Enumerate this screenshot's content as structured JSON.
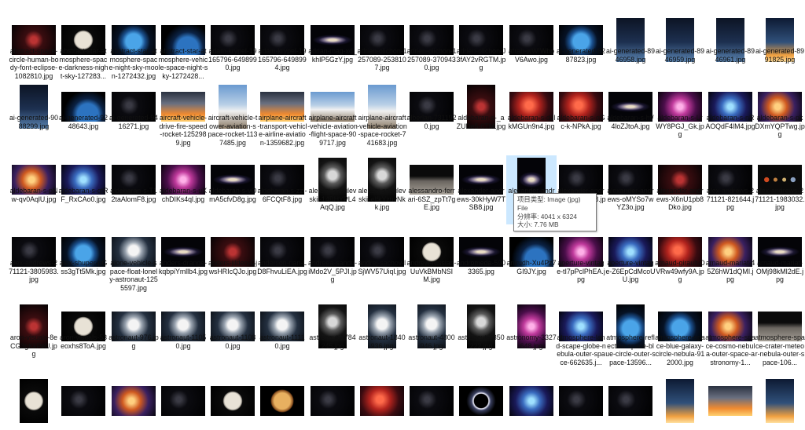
{
  "explorer": {
    "view": "large-icons",
    "tooltip": {
      "type_line": "项目类型: Image (jpg) File",
      "dims_line": "分辨率: 4041 x 6324",
      "size_line": "大小: 7.76 MB"
    },
    "rows": [
      [
        {
          "label": "abstract-space-circle-human-body-font-eclipse-1082810.jpg",
          "orient": "land",
          "style": "dark-red"
        },
        {
          "label": "abstract-star-atmosphere-space-darkness-night-sky-127283...",
          "orient": "land",
          "style": "moon"
        },
        {
          "label": "abstract-star-atmosphere-space-night-sky-moon-1272432.jpg",
          "orient": "land",
          "style": "earth"
        },
        {
          "label": "abstract-star-atmosphere-vehicle-space-night-sky-1272428...",
          "orient": "land",
          "style": "earth-dark"
        },
        {
          "label": "adam-krypel-19165796-6498990.jpg",
          "orient": "land",
          "style": "dark"
        },
        {
          "label": "adam-krypel-19165796-6498994.jpg",
          "orient": "land",
          "style": "dark"
        },
        {
          "label": "adrian-mag-xd_khlP5GzY.jpg",
          "orient": "land",
          "style": "galaxy"
        },
        {
          "label": "adrien-olichon-1257089-2538107.jpg",
          "orient": "land",
          "style": "dark"
        },
        {
          "label": "adrien-olichon-1257089-3709430.jpg",
          "orient": "land",
          "style": "dark"
        },
        {
          "label": "adrien-olichon-J3fAY2vRGTM.jpg",
          "orient": "land",
          "style": "dark"
        },
        {
          "label": "afrah-wW!Wbp V6Awo.jpg",
          "orient": "land",
          "style": "dark"
        },
        {
          "label": "ai-generated-8287823.jpg",
          "orient": "land",
          "style": "earth"
        },
        {
          "label": "ai-generated-8946958.jpg",
          "orient": "port",
          "style": "satellite"
        },
        {
          "label": "ai-generated-8946959.jpg",
          "orient": "port",
          "style": "satellite"
        },
        {
          "label": "ai-generated-8946961.jpg",
          "orient": "port",
          "style": "satellite"
        },
        {
          "label": "ai-generated-8991825.jpg",
          "orient": "port",
          "style": "rocket"
        }
      ],
      [
        {
          "label": "ai-generated-9088299.jpg",
          "orient": "port",
          "style": "satellite"
        },
        {
          "label": "ai-generated-9248643.jpg",
          "orient": "land",
          "style": "earth-dark"
        },
        {
          "label": "ai-generated-9416271.jpg",
          "orient": "land",
          "style": "dark"
        },
        {
          "label": "aircraft-vehicle-drive-fire-speed-rocket-1252989.jpg",
          "orient": "land",
          "style": "launch"
        },
        {
          "label": "aircraft-vehicle-tower-aviation-space-rocket-1137485.jpg",
          "orient": "port",
          "style": "shuttle"
        },
        {
          "label": "airplane-aircraft-transport-vehicle-airline-aviation-1359682.jpg",
          "orient": "land",
          "style": "launch"
        },
        {
          "label": "airplane-aircraft-vehicle-aviation-flight-space-909717.jpg",
          "orient": "land",
          "style": "shuttle"
        },
        {
          "label": "airplane-aircraft-vehicle-aviation-space-rocket-741683.jpg",
          "orient": "port",
          "style": "shuttle"
        },
        {
          "label": "alberlan-7311920.jpg",
          "orient": "land",
          "style": "dark"
        },
        {
          "label": "aldebaran-s-_aZUDe5-0TM.jpg",
          "orient": "port",
          "style": "dark-red"
        },
        {
          "label": "aldebaran-s-dJlkMGUn9n4.jpg",
          "orient": "land",
          "style": "nebula-red"
        },
        {
          "label": "aldebaran-s-gGc-k-NPkA.jpg",
          "orient": "land",
          "style": "nebula-red"
        },
        {
          "label": "aldebaran-s-ht/4loZJtoA.jpg",
          "orient": "land",
          "style": "galaxy"
        },
        {
          "label": "aldebaran-s-LrWY8PGJ_Gk.jpg",
          "orient": "land",
          "style": "nebula-pink"
        },
        {
          "label": "aldebaran-s-nRAOQdF4lM4.jpg",
          "orient": "land",
          "style": "nebula-blue"
        },
        {
          "label": "aldebaran-s-pkDXmYQPTwg.jpg",
          "orient": "land",
          "style": "nebula-orange"
        }
      ],
      [
        {
          "label": "aldebaran-s-pNw-qv0AqlU.jpg",
          "orient": "land",
          "style": "nebula-orange"
        },
        {
          "label": "aldebaran-s-qtRF_RxCAo0.jpg",
          "orient": "land",
          "style": "nebula-blue"
        },
        {
          "label": "aldebaran-s-T12taAlomF8.jpg",
          "orient": "land",
          "style": "dark"
        },
        {
          "label": "aldebaran-s-uXchDIKs4ql.jpg",
          "orient": "land",
          "style": "nebula-pink"
        },
        {
          "label": "aldebaran-s-vOmA5cfvD8g.jpg",
          "orient": "land",
          "style": "galaxy"
        },
        {
          "label": "aldebaran-s-zzi-6FCQtF8.jpg",
          "orient": "land",
          "style": "dark"
        },
        {
          "label": "aleksei-sabulevskii-14BHYPL4AqQ.jpg",
          "orient": "port",
          "style": "astronaut-dark"
        },
        {
          "label": "aleksei-sabulevskii-elfkYzuvNkk.jpg",
          "orient": "port",
          "style": "astronaut-dark"
        },
        {
          "label": "alessandro-ferrari-6SZ_zpTt7gE.jpg",
          "orient": "land",
          "style": "moon-surface"
        },
        {
          "label": "alexander-andrews-30kHyW7TSB8.jpg",
          "orient": "land",
          "style": "galaxy"
        },
        {
          "label": "alexander-andrews-...8.jpg",
          "orient": "port",
          "style": "galaxy",
          "selected": true
        },
        {
          "label": "alexander-andrews-...-UFW8.jpg",
          "orient": "land",
          "style": "dark"
        },
        {
          "label": "alexander-andrews-oMYSo7wYZ3o.jpg",
          "orient": "land",
          "style": "dark"
        },
        {
          "label": "alexander-andrews-X6nU1pb8Dko.jpg",
          "orient": "land",
          "style": "dark-red"
        },
        {
          "label": "alex-andrews-271121-821644.jpg",
          "orient": "land",
          "style": "dark"
        },
        {
          "label": "alex-andrews-271121-1983032.jpg",
          "orient": "land",
          "style": "planets"
        }
      ],
      [
        {
          "label": "alex-andrews-271121-3805983.jpg",
          "orient": "land",
          "style": "dark"
        },
        {
          "label": "alex-shuper-pGss3gTt5Mk.jpg",
          "orient": "land",
          "style": "earth"
        },
        {
          "label": "alone-vehicle-space-float-lonely-astronaut-1255597.jpg",
          "orient": "land",
          "style": "astronaut"
        },
        {
          "label": "anders-drange-kqbpiYmllb4.jpg",
          "orient": "land",
          "style": "galaxy"
        },
        {
          "label": "anders-jilden-GjwsHRIcQJo.jpg",
          "orient": "land",
          "style": "dark-red"
        },
        {
          "label": "anderson-rian-LD8FhvuLiEA.jpg",
          "orient": "land",
          "style": "dark"
        },
        {
          "label": "andreea-sandu-iMdo2V_5PJI.jpg",
          "orient": "land",
          "style": "dark"
        },
        {
          "label": "andrej-sachov-lSjWV57Uiql.jpg",
          "orient": "land",
          "style": "dark"
        },
        {
          "label": "andrew-russian-UuVkBMbNSIM.jpg",
          "orient": "land",
          "style": "moon"
        },
        {
          "label": "andromeda-5903365.jpg",
          "orient": "land",
          "style": "galaxy"
        },
        {
          "label": "anirudh-Xu4Pz7GI9JY.jpg",
          "orient": "land",
          "style": "earth-dark"
        },
        {
          "label": "aperture-vintage-tI7pPclPhEA.jpg",
          "orient": "land",
          "style": "nebula-pink"
        },
        {
          "label": "aperture-vintage-Z6EpCdMcoUU.jpg",
          "orient": "land",
          "style": "nebula-blue"
        },
        {
          "label": "arnaud-girault-DVRw49wfy9A.jpg",
          "orient": "land",
          "style": "nebula-red"
        },
        {
          "label": "arnaud-mariat-45Z6hW1dQMI.jpg",
          "orient": "land",
          "style": "nebula-orange"
        },
        {
          "label": "arnaud-mariat-OMj98kMI2dE.jpg",
          "orient": "land",
          "style": "galaxy"
        }
      ],
      [
        {
          "label": "aron-visuals-8eCG3gKkPeU.jpg",
          "orient": "port",
          "style": "dark-red"
        },
        {
          "label": "aron-visuals-53eoxhs8ToA.jpg",
          "orient": "land",
          "style": "moon"
        },
        {
          "label": "astronaut-976.jpg",
          "orient": "land",
          "style": "astronaut"
        },
        {
          "label": "astronaut-11050.jpg",
          "orient": "land",
          "style": "astronaut"
        },
        {
          "label": "astronaut-11080.jpg",
          "orient": "land",
          "style": "astronaut"
        },
        {
          "label": "astronaut-11110.jpg",
          "orient": "land",
          "style": "astronaut"
        },
        {
          "label": "astronaut-1784245.jpg",
          "orient": "port",
          "style": "astronaut-dark"
        },
        {
          "label": "astronaut-1840936.jpg",
          "orient": "port",
          "style": "astronaut"
        },
        {
          "label": "astronaut-4800946.jpg",
          "orient": "port",
          "style": "astronaut"
        },
        {
          "label": "astronaut-7350222.jpg",
          "orient": "port",
          "style": "astronaut-dark"
        },
        {
          "label": "astronomy-3327648.jpg",
          "orient": "port",
          "style": "nebula-pink"
        },
        {
          "label": "atmosphere-land-scape-globe-nebula-outer-space-662635.j...",
          "orient": "land",
          "style": "nebula-blue"
        },
        {
          "label": "atmosphere-reflection-space-blue-circle-outer-space-13596...",
          "orient": "port",
          "style": "earth"
        },
        {
          "label": "atmosphere-space-blue-galaxy-circle-nebula-912000.jpg",
          "orient": "land",
          "style": "earth"
        },
        {
          "label": "atmosphere-space-cosmo-nebula-outer-space-astronomy-1...",
          "orient": "land",
          "style": "nebula-orange"
        },
        {
          "label": "atmosphere-space-crater-meteor-nebula-outer-space-106...",
          "orient": "land",
          "style": "moon-surface"
        }
      ],
      [
        {
          "label": "",
          "orient": "port",
          "style": "moon"
        },
        {
          "label": "",
          "orient": "land",
          "style": "dark"
        },
        {
          "label": "",
          "orient": "land",
          "style": "nebula-orange"
        },
        {
          "label": "",
          "orient": "land",
          "style": "dark"
        },
        {
          "label": "",
          "orient": "land",
          "style": "moon"
        },
        {
          "label": "",
          "orient": "land",
          "style": "planet-orange"
        },
        {
          "label": "",
          "orient": "land",
          "style": "dark"
        },
        {
          "label": "",
          "orient": "land",
          "style": "nebula-red"
        },
        {
          "label": "",
          "orient": "land",
          "style": "dark"
        },
        {
          "label": "",
          "orient": "land",
          "style": "eclipse"
        },
        {
          "label": "",
          "orient": "land",
          "style": "nebula-blue"
        },
        {
          "label": "",
          "orient": "land",
          "style": "dark"
        },
        {
          "label": "",
          "orient": "land",
          "style": "dark"
        },
        {
          "label": "",
          "orient": "port",
          "style": "rocket"
        },
        {
          "label": "",
          "orient": "land",
          "style": "launch"
        },
        {
          "label": "",
          "orient": "port",
          "style": "rocket"
        }
      ]
    ]
  }
}
